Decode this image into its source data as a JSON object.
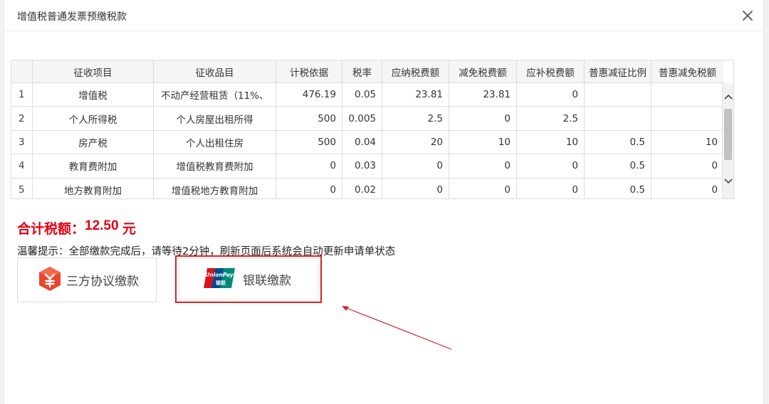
{
  "dialog": {
    "title": "增值税普通发票预缴税款"
  },
  "table": {
    "headers": [
      "",
      "征收项目",
      "征收品目",
      "计税依据",
      "税率",
      "应纳税费额",
      "减免税费额",
      "应补税费额",
      "普惠减征比例",
      "普惠减免税额"
    ],
    "rows": [
      [
        "1",
        "增值税",
        "不动产经营租赁（11%、",
        "476.19",
        "0.05",
        "23.81",
        "23.81",
        "0",
        "",
        ""
      ],
      [
        "2",
        "个人所得税",
        "个人房屋出租所得",
        "500",
        "0.005",
        "2.5",
        "0",
        "2.5",
        "",
        ""
      ],
      [
        "3",
        "房产税",
        "个人出租住房",
        "500",
        "0.04",
        "20",
        "10",
        "10",
        "0.5",
        "10"
      ],
      [
        "4",
        "教育费附加",
        "增值税教育费附加",
        "0",
        "0.03",
        "0",
        "0",
        "0",
        "0.5",
        "0"
      ],
      [
        "5",
        "地方教育附加",
        "增值税地方教育附加",
        "0",
        "0.02",
        "0",
        "0",
        "0",
        "0.5",
        "0"
      ]
    ]
  },
  "summary": {
    "total_label": "合计税额：",
    "total_value": "12.50",
    "total_unit": " 元",
    "tip": "温馨提示：全部缴款完成后，请等待2分钟，刷新页面后系统会自动更新申请单状态"
  },
  "payment": {
    "third_party_label": "三方协议缴款",
    "unionpay_label": "银联缴款",
    "unionpay_logo_text": "UnionPay",
    "unionpay_logo_sub": "银联"
  },
  "colors": {
    "accent_red": "#e60012",
    "highlight_border": "#e02020"
  }
}
